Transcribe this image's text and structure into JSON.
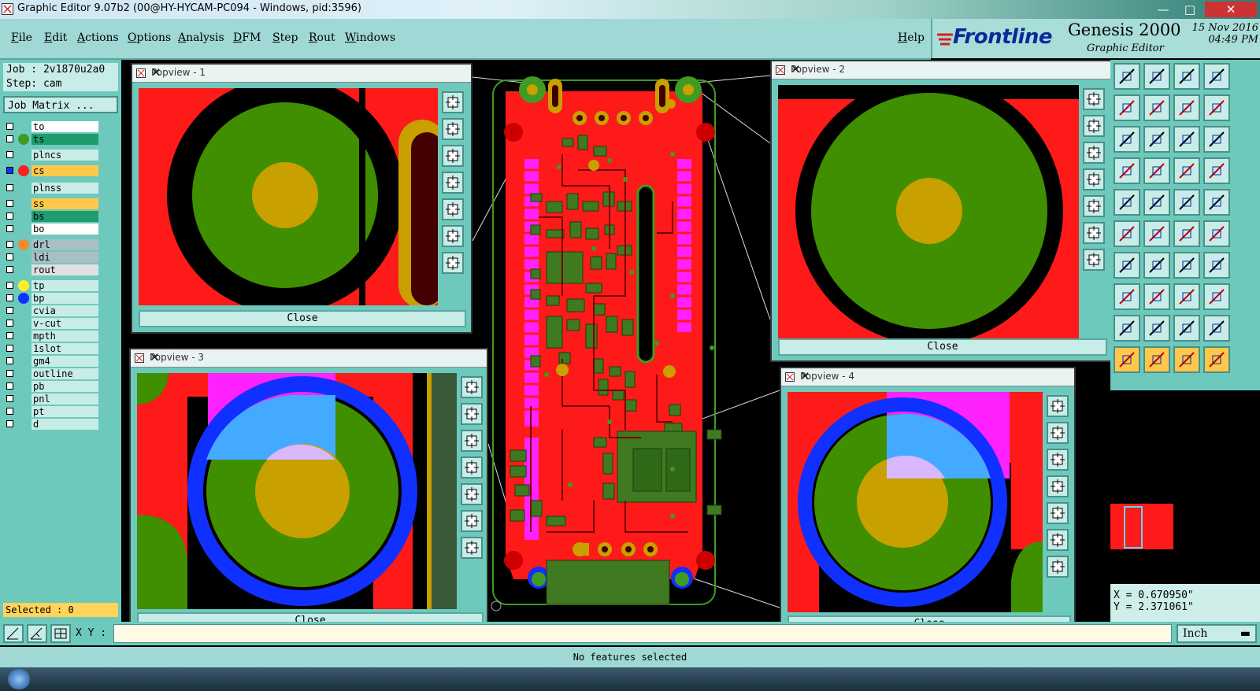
{
  "window": {
    "title": "Graphic Editor 9.07b2 (00@HY-HYCAM-PC094 - Windows, pid:3596)"
  },
  "menu": [
    "File",
    "Edit",
    "Actions",
    "Options",
    "Analysis",
    "DFM",
    "Step",
    "Rout",
    "Windows"
  ],
  "help": "Help",
  "brand": {
    "logo": "Frontline",
    "product": "Genesis 2000",
    "subtitle": "Graphic Editor",
    "date": "15 Nov 2016",
    "time": "04:49 PM"
  },
  "job": {
    "label": "Job : 2v1870u2a0",
    "step": "Step: cam",
    "matrix_button": "Job Matrix ..."
  },
  "layers": [
    {
      "name": "to",
      "bg": "#ffffff",
      "dot": ""
    },
    {
      "name": "ts",
      "bg": "#1f9c6e",
      "dot": "#3f9b22"
    },
    {
      "name": "plncs",
      "bg": "#c8ece8",
      "dot": ""
    },
    {
      "name": "cs",
      "bg": "#ffc84a",
      "dot": "#ff2020"
    },
    {
      "name": "plnss",
      "bg": "#c8ece8",
      "dot": ""
    },
    {
      "name": "ss",
      "bg": "#ffc84a",
      "dot": ""
    },
    {
      "name": "bs",
      "bg": "#1f9c6e",
      "dot": ""
    },
    {
      "name": "bo",
      "bg": "#ffffff",
      "dot": ""
    },
    {
      "name": "drl",
      "bg": "#a9bfc6",
      "dot": "#f08a30"
    },
    {
      "name": "ldi",
      "bg": "#a9bfc6",
      "dot": ""
    },
    {
      "name": "rout",
      "bg": "#e0e0e0",
      "dot": ""
    },
    {
      "name": "tp",
      "bg": "#c8ece8",
      "dot": "#ffee22"
    },
    {
      "name": "bp",
      "bg": "#c8ece8",
      "dot": "#1030ff"
    },
    {
      "name": "cvia",
      "bg": "#c8ece8",
      "dot": ""
    },
    {
      "name": "v-cut",
      "bg": "#c8ece8",
      "dot": ""
    },
    {
      "name": "mpth",
      "bg": "#c8ece8",
      "dot": ""
    },
    {
      "name": "1slot",
      "bg": "#c8ece8",
      "dot": ""
    },
    {
      "name": "gm4",
      "bg": "#c8ece8",
      "dot": ""
    },
    {
      "name": "outline",
      "bg": "#c8ece8",
      "dot": ""
    },
    {
      "name": "pb",
      "bg": "#c8ece8",
      "dot": ""
    },
    {
      "name": "pnl",
      "bg": "#c8ece8",
      "dot": ""
    },
    {
      "name": "pt",
      "bg": "#c8ece8",
      "dot": ""
    },
    {
      "name": "d",
      "bg": "#c8ece8",
      "dot": ""
    }
  ],
  "selected": "Selected : 0",
  "popviews": [
    {
      "title": "Popview - 1",
      "close": "Close"
    },
    {
      "title": "Popview - 2",
      "close": "Close"
    },
    {
      "title": "Popview - 3",
      "close": "Close"
    },
    {
      "title": "Popview - 4",
      "close": "Close"
    }
  ],
  "coords": {
    "x": "X = 0.670950\"",
    "y": "Y = 2.371061\""
  },
  "xy_label": "X Y :",
  "units": "Inch",
  "status": "No features selected",
  "colors": {
    "copper": "#ff1a1a",
    "mask": "#3f8f00",
    "drill": "#c8a000",
    "magenta": "#ff22ff",
    "blue": "#1030ff",
    "panel": "#6ec9bd"
  }
}
